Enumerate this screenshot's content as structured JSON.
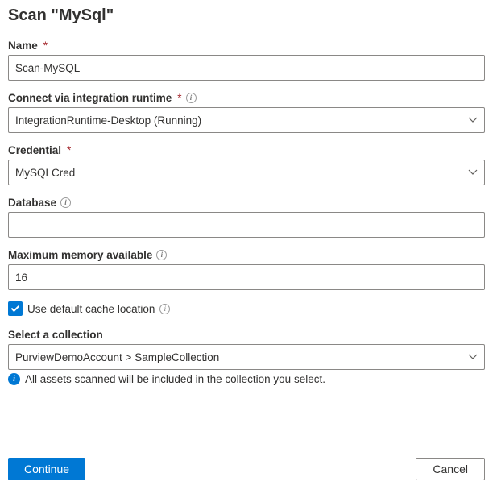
{
  "title": "Scan \"MySql\"",
  "fields": {
    "name": {
      "label": "Name",
      "required": true,
      "value": "Scan-MySQL"
    },
    "runtime": {
      "label": "Connect via integration runtime",
      "required": true,
      "has_info": true,
      "value": "IntegrationRuntime-Desktop (Running)"
    },
    "credential": {
      "label": "Credential",
      "required": true,
      "value": "MySQLCred"
    },
    "database": {
      "label": "Database",
      "has_info": true,
      "value": ""
    },
    "memory": {
      "label": "Maximum memory available",
      "has_info": true,
      "value": "16"
    },
    "cache": {
      "label": "Use default cache location",
      "checked": true,
      "has_info": true
    },
    "collection": {
      "label": "Select a collection",
      "value": "PurviewDemoAccount > SampleCollection",
      "hint": "All assets scanned will be included in the collection you select."
    }
  },
  "footer": {
    "continue": "Continue",
    "cancel": "Cancel"
  }
}
